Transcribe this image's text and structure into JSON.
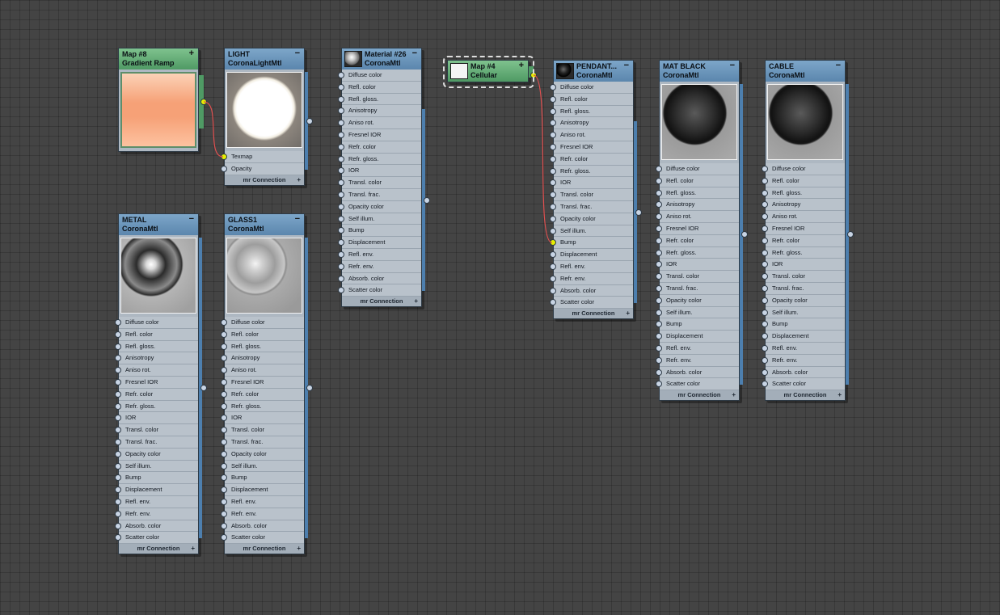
{
  "colors": {
    "canvas": "#444444",
    "wire": "#e05050",
    "socket_active": "#e6f000"
  },
  "ui": {
    "footer_label": "mr Connection",
    "footer_plus": "+",
    "collapse_symbol": "−",
    "expand_symbol": "+"
  },
  "nodes": [
    {
      "id": "map8",
      "kind": "map",
      "title": "Map #8",
      "subtitle": "Gradient Ramp",
      "preview": "gradient-ramp",
      "collapse": "+",
      "slots": [],
      "footer": false
    },
    {
      "id": "light",
      "kind": "mtl",
      "title": "LIGHT",
      "subtitle": "CoronaLightMtl",
      "preview": "light-sphere",
      "collapse": "−",
      "slots": [
        "Texmap",
        "Opacity"
      ],
      "active_slot": "Texmap",
      "footer": true
    },
    {
      "id": "material26",
      "kind": "mtl",
      "title": "Material #26",
      "subtitle": "CoronaMtl",
      "preview": "none",
      "icon": "gray-sphere",
      "collapse": "−",
      "slots": [
        "Diffuse color",
        "Refl. color",
        "Refl. gloss.",
        "Anisotropy",
        "Aniso rot.",
        "Fresnel IOR",
        "Refr. color",
        "Refr. gloss.",
        "IOR",
        "Transl. color",
        "Transl. frac.",
        "Opacity color",
        "Self illum.",
        "Bump",
        "Displacement",
        "Refl. env.",
        "Refr. env.",
        "Absorb. color",
        "Scatter color"
      ],
      "footer": true
    },
    {
      "id": "map4",
      "kind": "map",
      "title": "Map #4",
      "subtitle": "Cellular",
      "preview": "none",
      "icon": "white-swatch",
      "collapse": "+",
      "slots": [],
      "footer": false
    },
    {
      "id": "pendant",
      "kind": "mtl",
      "title": "PENDANT...",
      "subtitle": "CoronaMtl",
      "preview": "none",
      "icon": "black-sphere",
      "collapse": "−",
      "slots": [
        "Diffuse color",
        "Refl. color",
        "Refl. gloss.",
        "Anisotropy",
        "Aniso rot.",
        "Fresnel IOR",
        "Refr. color",
        "Refr. gloss.",
        "IOR",
        "Transl. color",
        "Transl. frac.",
        "Opacity color",
        "Self illum.",
        "Bump",
        "Displacement",
        "Refl. env.",
        "Refr. env.",
        "Absorb. color",
        "Scatter color"
      ],
      "active_slot": "Bump",
      "footer": true
    },
    {
      "id": "matblack",
      "kind": "mtl",
      "title": "MAT BLACK",
      "subtitle": "CoronaMtl",
      "preview": "dark-sphere",
      "collapse": "−",
      "slots": [
        "Diffuse color",
        "Refl. color",
        "Refl. gloss.",
        "Anisotropy",
        "Aniso rot.",
        "Fresnel IOR",
        "Refr. color",
        "Refr. gloss.",
        "IOR",
        "Transl. color",
        "Transl. frac.",
        "Opacity color",
        "Self illum.",
        "Bump",
        "Displacement",
        "Refl. env.",
        "Refr. env.",
        "Absorb. color",
        "Scatter color"
      ],
      "footer": true
    },
    {
      "id": "cable",
      "kind": "mtl",
      "title": "CABLE",
      "subtitle": "CoronaMtl",
      "preview": "dark-sphere",
      "collapse": "−",
      "slots": [
        "Diffuse color",
        "Refl. color",
        "Refl. gloss.",
        "Anisotropy",
        "Aniso rot.",
        "Fresnel IOR",
        "Refr. color",
        "Refr. gloss.",
        "IOR",
        "Transl. color",
        "Transl. frac.",
        "Opacity color",
        "Self illum.",
        "Bump",
        "Displacement",
        "Refl. env.",
        "Refr. env.",
        "Absorb. color",
        "Scatter color"
      ],
      "footer": true
    },
    {
      "id": "metal",
      "kind": "mtl",
      "title": "METAL",
      "subtitle": "CoronaMtl",
      "preview": "chrome-sphere",
      "collapse": "−",
      "slots": [
        "Diffuse color",
        "Refl. color",
        "Refl. gloss.",
        "Anisotropy",
        "Aniso rot.",
        "Fresnel IOR",
        "Refr. color",
        "Refr. gloss.",
        "IOR",
        "Transl. color",
        "Transl. frac.",
        "Opacity color",
        "Self illum.",
        "Bump",
        "Displacement",
        "Refl. env.",
        "Refr. env.",
        "Absorb. color",
        "Scatter color"
      ],
      "footer": true
    },
    {
      "id": "glass1",
      "kind": "mtl",
      "title": "GLASS1",
      "subtitle": "CoronaMtl",
      "preview": "glass-sphere",
      "collapse": "−",
      "slots": [
        "Diffuse color",
        "Refl. color",
        "Refl. gloss.",
        "Anisotropy",
        "Aniso rot.",
        "Fresnel IOR",
        "Refr. color",
        "Refr. gloss.",
        "IOR",
        "Transl. color",
        "Transl. frac.",
        "Opacity color",
        "Self illum.",
        "Bump",
        "Displacement",
        "Refl. env.",
        "Refr. env.",
        "Absorb. color",
        "Scatter color"
      ],
      "footer": true
    }
  ],
  "connections": [
    {
      "from": "map8",
      "to": "light",
      "slot": "Texmap"
    },
    {
      "from": "map4",
      "to": "pendant",
      "slot": "Bump"
    }
  ]
}
